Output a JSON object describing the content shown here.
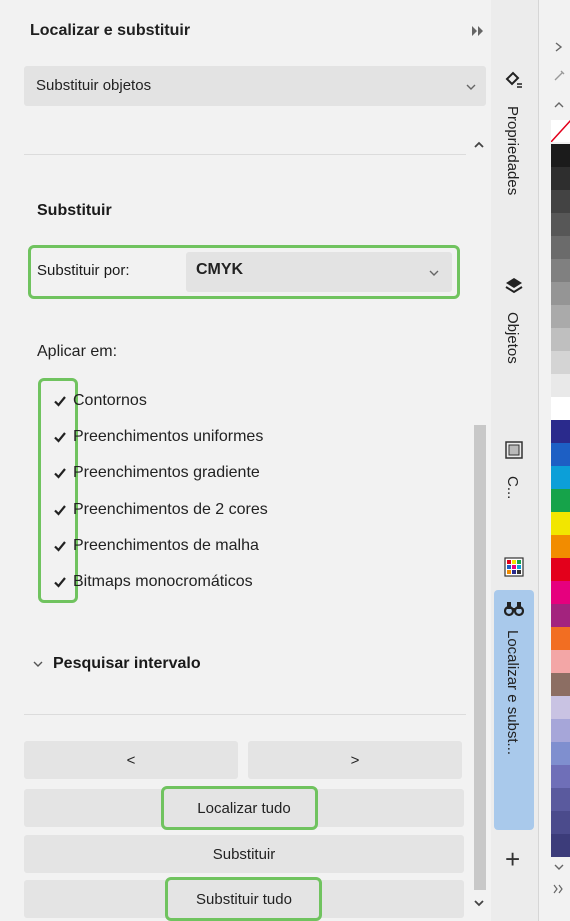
{
  "docker": {
    "title": "Localizar e substituir",
    "collapse_icon": "double-chevron-right-icon",
    "close_icon": "close-icon",
    "mode": "Substituir objetos"
  },
  "replace": {
    "section_title": "Substituir",
    "replace_by_label": "Substituir por:",
    "replace_by_value": "CMYK",
    "apply_label": "Aplicar em:",
    "options": [
      {
        "label": "Contornos",
        "checked": true
      },
      {
        "label": "Preenchimentos uniformes",
        "checked": true
      },
      {
        "label": "Preenchimentos gradiente",
        "checked": true
      },
      {
        "label": "Preenchimentos de 2 cores",
        "checked": true
      },
      {
        "label": "Preenchimentos de malha",
        "checked": true
      },
      {
        "label": "Bitmaps monocromáticos",
        "checked": true
      }
    ],
    "range_label": "Pesquisar intervalo"
  },
  "buttons": {
    "prev": "<",
    "next": ">",
    "find_all": "Localizar tudo",
    "replace": "Substituir",
    "replace_all": "Substituir tudo"
  },
  "tabs": [
    {
      "label": "Propriedades",
      "icon": "properties-icon",
      "active": false
    },
    {
      "label": "Objetos",
      "icon": "layers-icon",
      "active": false
    },
    {
      "label": "C...",
      "icon": "frame-icon",
      "active": false
    },
    {
      "label": "Localizar e subst...",
      "icon": "binoculars-icon",
      "active": true
    }
  ],
  "tab_add": "+",
  "colors": {
    "highlight": "#70c35f",
    "active_tab": "#a9c9eb",
    "palette": [
      "#1b1b1b",
      "#2e2e2e",
      "#434343",
      "#575757",
      "#6b6b6b",
      "#808080",
      "#959595",
      "#aaaaaa",
      "#bfbfbf",
      "#d4d4d4",
      "#e9e9e9",
      "#ffffff",
      "#2a2a8c",
      "#1d5fc4",
      "#0c9fd8",
      "#16a34a",
      "#f2e600",
      "#f28c00",
      "#e3001b",
      "#e6007e",
      "#a3237e",
      "#f26e22",
      "#f3a6a6",
      "#8c6e63",
      "#c9c3e3",
      "#a6a6d9",
      "#7f8fcf",
      "#6f6fb8",
      "#5a5a9e",
      "#4b4b8c",
      "#3c3c7a"
    ]
  }
}
